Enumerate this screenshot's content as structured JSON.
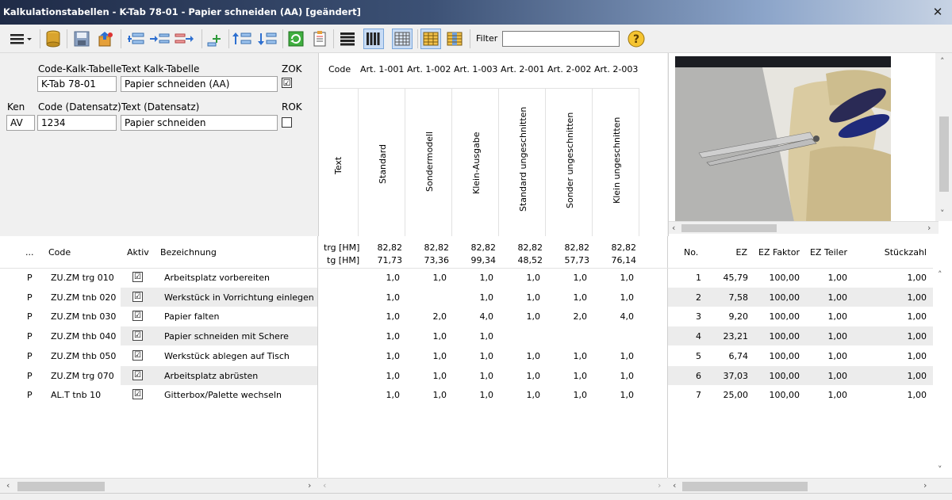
{
  "window": {
    "title": "Kalkulationstabellen - K-Tab 78-01 - Papier schneiden (AA) [geändert]",
    "close_glyph": "✕"
  },
  "toolbar": {
    "filter_label": "Filter",
    "filter_value": "",
    "icons": [
      "menu-icon",
      "database-icon",
      "save-icon",
      "export-icon",
      "insert-row-icon",
      "indent-icon",
      "outdent-icon",
      "add-icon",
      "move-up-icon",
      "move-down-icon",
      "refresh-icon",
      "report-icon",
      "list-view-icon",
      "column-view-icon",
      "grid-view-icon",
      "highlight-view-icon",
      "color-grid-icon",
      "help-icon"
    ]
  },
  "header": {
    "code_kalk_label": "Code-Kalk-Tabelle",
    "code_kalk_value": "K-Tab 78-01",
    "text_kalk_label": "Text Kalk-Tabelle",
    "text_kalk_value": "Papier schneiden (AA)",
    "zok_label": "ZOK",
    "zok_checked": "☑",
    "ken_label": "Ken",
    "ken_value": "AV",
    "code_ds_label": "Code (Datensatz)",
    "code_ds_value": "1234",
    "text_ds_label": "Text (Datensatz)",
    "text_ds_value": "Papier schneiden",
    "rok_label": "ROK"
  },
  "articles": {
    "code_label": "Code",
    "text_label": "Text",
    "columns": [
      {
        "code": "Art. 1-001",
        "text": "Standard"
      },
      {
        "code": "Art. 1-002",
        "text": "Sondermodell"
      },
      {
        "code": "Art. 1-003",
        "text": "Klein-Ausgabe"
      },
      {
        "code": "Art. 2-001",
        "text": "Standard ungeschnitten"
      },
      {
        "code": "Art. 2-002",
        "text": "Sonder ungeschnitten"
      },
      {
        "code": "Art. 2-003",
        "text": "Klein ungeschnitten"
      }
    ],
    "trg_label": "trg [HM]",
    "tg_label": "tg [HM]",
    "trg_values": [
      "82,82",
      "82,82",
      "82,82",
      "82,82",
      "82,82",
      "82,82"
    ],
    "tg_values": [
      "71,73",
      "73,36",
      "99,34",
      "48,52",
      "57,73",
      "76,14"
    ]
  },
  "grid": {
    "headers": {
      "dots": "...",
      "code": "Code",
      "aktiv": "Aktiv",
      "bezeichnung": "Bezeichnung",
      "no": "No.",
      "ez": "EZ",
      "ez_faktor": "EZ Faktor",
      "ez_teiler": "EZ Teiler",
      "stueckzahl": "Stückzahl"
    },
    "rows": [
      {
        "type": "P",
        "code": "ZU.ZM trg 010",
        "aktiv": "☑",
        "bez": "Arbeitsplatz vorbereiten",
        "vals": [
          "1,0",
          "1,0",
          "1,0",
          "1,0",
          "1,0",
          "1,0"
        ],
        "no": "1",
        "ez": "45,79",
        "faktor": "100,00",
        "teiler": "1,00",
        "stueck": "1,00"
      },
      {
        "type": "P",
        "code": "ZU.ZM tnb 020",
        "aktiv": "☑",
        "bez": "Werkstück in Vorrichtung einlegen",
        "vals": [
          "1,0",
          "",
          "1,0",
          "1,0",
          "1,0",
          "1,0"
        ],
        "no": "2",
        "ez": "7,58",
        "faktor": "100,00",
        "teiler": "1,00",
        "stueck": "1,00"
      },
      {
        "type": "P",
        "code": "ZU.ZM tnb 030",
        "aktiv": "☑",
        "bez": "Papier falten",
        "vals": [
          "1,0",
          "2,0",
          "4,0",
          "1,0",
          "2,0",
          "4,0"
        ],
        "no": "3",
        "ez": "9,20",
        "faktor": "100,00",
        "teiler": "1,00",
        "stueck": "1,00"
      },
      {
        "type": "P",
        "code": "ZU.ZM thb 040",
        "aktiv": "☑",
        "bez": "Papier schneiden mit Schere",
        "vals": [
          "1,0",
          "1,0",
          "1,0",
          "",
          "",
          ""
        ],
        "no": "4",
        "ez": "23,21",
        "faktor": "100,00",
        "teiler": "1,00",
        "stueck": "1,00"
      },
      {
        "type": "P",
        "code": "ZU.ZM thb 050",
        "aktiv": "☑",
        "bez": "Werkstück ablegen auf Tisch",
        "vals": [
          "1,0",
          "1,0",
          "1,0",
          "1,0",
          "1,0",
          "1,0"
        ],
        "no": "5",
        "ez": "6,74",
        "faktor": "100,00",
        "teiler": "1,00",
        "stueck": "1,00"
      },
      {
        "type": "P",
        "code": "ZU.ZM trg 070",
        "aktiv": "☑",
        "bez": "Arbeitsplatz abrüsten",
        "vals": [
          "1,0",
          "1,0",
          "1,0",
          "1,0",
          "1,0",
          "1,0"
        ],
        "no": "6",
        "ez": "37,03",
        "faktor": "100,00",
        "teiler": "1,00",
        "stueck": "1,00"
      },
      {
        "type": "P",
        "code": "AL.T tnb 10",
        "aktiv": "☑",
        "bez": "Gitterbox/Palette wechseln",
        "vals": [
          "1,0",
          "1,0",
          "1,0",
          "1,0",
          "1,0",
          "1,0"
        ],
        "no": "7",
        "ez": "25,00",
        "faktor": "100,00",
        "teiler": "1,00",
        "stueck": "1,00"
      }
    ]
  },
  "scroll": {
    "left": "‹",
    "right": "›",
    "up": "˄",
    "down": "˅"
  },
  "colors": {
    "title_start": "#1f2b47",
    "title_end": "#c7d3e4",
    "row_alt": "#ececec",
    "active_button": "#c8dcf5"
  }
}
